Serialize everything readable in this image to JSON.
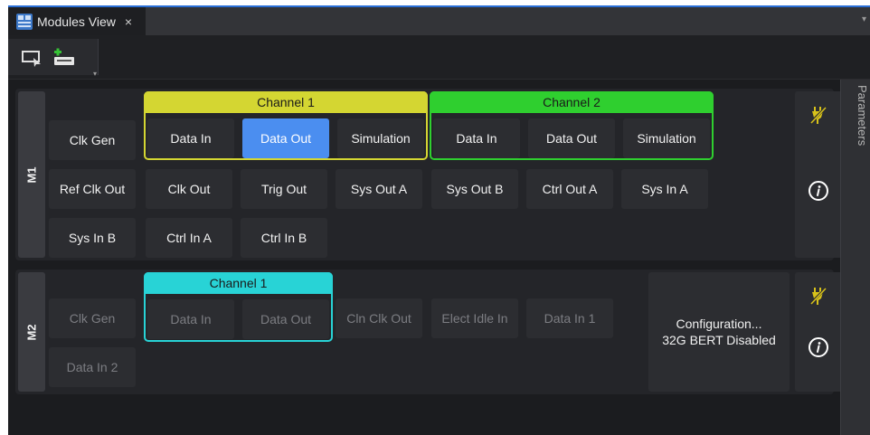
{
  "window": {
    "tab_title": "Modules View",
    "tab_close": "×",
    "tab_menu": "▾"
  },
  "toolbar": {
    "buttons": [
      {
        "icon": "select-region-icon"
      },
      {
        "icon": "add-module-icon"
      }
    ],
    "dropdown": "▾"
  },
  "side_panel": {
    "title": "Parameters"
  },
  "modules": [
    {
      "label": "M1",
      "channels": [
        {
          "title": "Channel 1",
          "color": "#d4d632",
          "cells": [
            "Data In",
            "Data Out",
            "Simulation"
          ],
          "active": "Data Out"
        },
        {
          "title": "Channel 2",
          "color": "#2fcf2f",
          "cells": [
            "Data In",
            "Data Out",
            "Simulation"
          ]
        }
      ],
      "cells": [
        "Clk Gen",
        "Ref Clk Out",
        "Clk Out",
        "Trig Out",
        "Sys Out A",
        "Sys Out B",
        "Ctrl Out A",
        "Sys In A",
        "Sys In B",
        "Ctrl In A",
        "Ctrl In B"
      ],
      "side_icons": [
        "power-plug-icon",
        "info-icon"
      ],
      "enabled": true
    },
    {
      "label": "M2",
      "channels": [
        {
          "title": "Channel 1",
          "color": "#28d3d6",
          "cells": [
            "Data In",
            "Data Out"
          ]
        }
      ],
      "cells": [
        "Clk Gen",
        "Cln Clk Out",
        "Elect Idle In",
        "Data In 1",
        "Data In 2"
      ],
      "config": {
        "line1": "Configuration...",
        "line2": "32G BERT Disabled"
      },
      "side_icons": [
        "power-plug-icon",
        "info-icon"
      ],
      "enabled": false
    }
  ]
}
